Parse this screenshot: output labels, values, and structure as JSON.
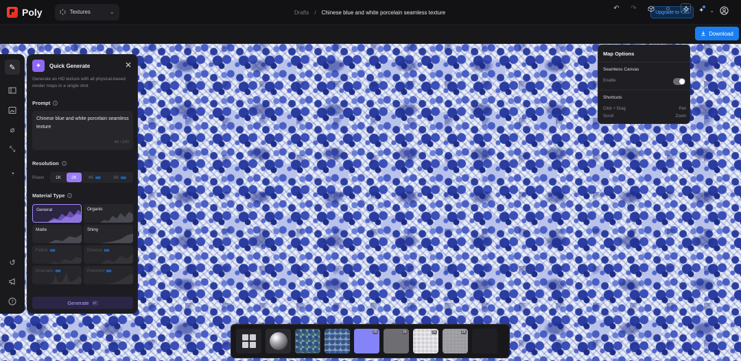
{
  "app": {
    "name": "Poly"
  },
  "header": {
    "project_select": "Textures",
    "breadcrumb": {
      "parent": "Drafts",
      "separator": "/",
      "current": "Chinese blue and white porcelain seamless texture"
    },
    "upgrade_label": "Upgrade to",
    "upgrade_badge": "OO"
  },
  "toolbar": {
    "download_label": "Download"
  },
  "panel": {
    "title": "Quick Generate",
    "description": "Generate an HD texture with all physical-based render maps in a single shot",
    "prompt_label": "Prompt",
    "prompt_value": "Chinese blue and white porcelain seamless texture",
    "prompt_count": "48 / 240",
    "resolution_label": "Resolution",
    "pixels_label": "Pixels",
    "resolutions": [
      {
        "label": "1K"
      },
      {
        "label": "2K"
      },
      {
        "label": "4K",
        "badge": "OO"
      },
      {
        "label": "8K",
        "badge": "OO"
      }
    ],
    "material_label": "Material Type",
    "materials": [
      {
        "label": "General"
      },
      {
        "label": "Organic"
      },
      {
        "label": "Matte"
      },
      {
        "label": "Shiny"
      },
      {
        "label": "Fabric",
        "badge": "OO"
      },
      {
        "label": "Diverse",
        "badge": "OO"
      },
      {
        "label": "Dramatic",
        "badge": "OO"
      },
      {
        "label": "Polished",
        "badge": "OO"
      }
    ],
    "generate_label": "Generate",
    "generate_key": "↵"
  },
  "map_options": {
    "title": "Map Options",
    "seamless_heading": "Seamless Canvas",
    "enable_label": "Enable",
    "enabled": true,
    "shortcuts_heading": "Shortcuts",
    "shortcuts": [
      {
        "action": "Click + Drag",
        "result": "Pan"
      },
      {
        "action": "Scroll",
        "result": "Zoom"
      }
    ]
  },
  "map_strip": {
    "badges": [
      "2K",
      "2K",
      "2K",
      "2K",
      "2K"
    ]
  },
  "colors": {
    "accent": "#9b7cf7",
    "download": "#1a7ef0",
    "upgrade_text": "#5aa6ff"
  }
}
